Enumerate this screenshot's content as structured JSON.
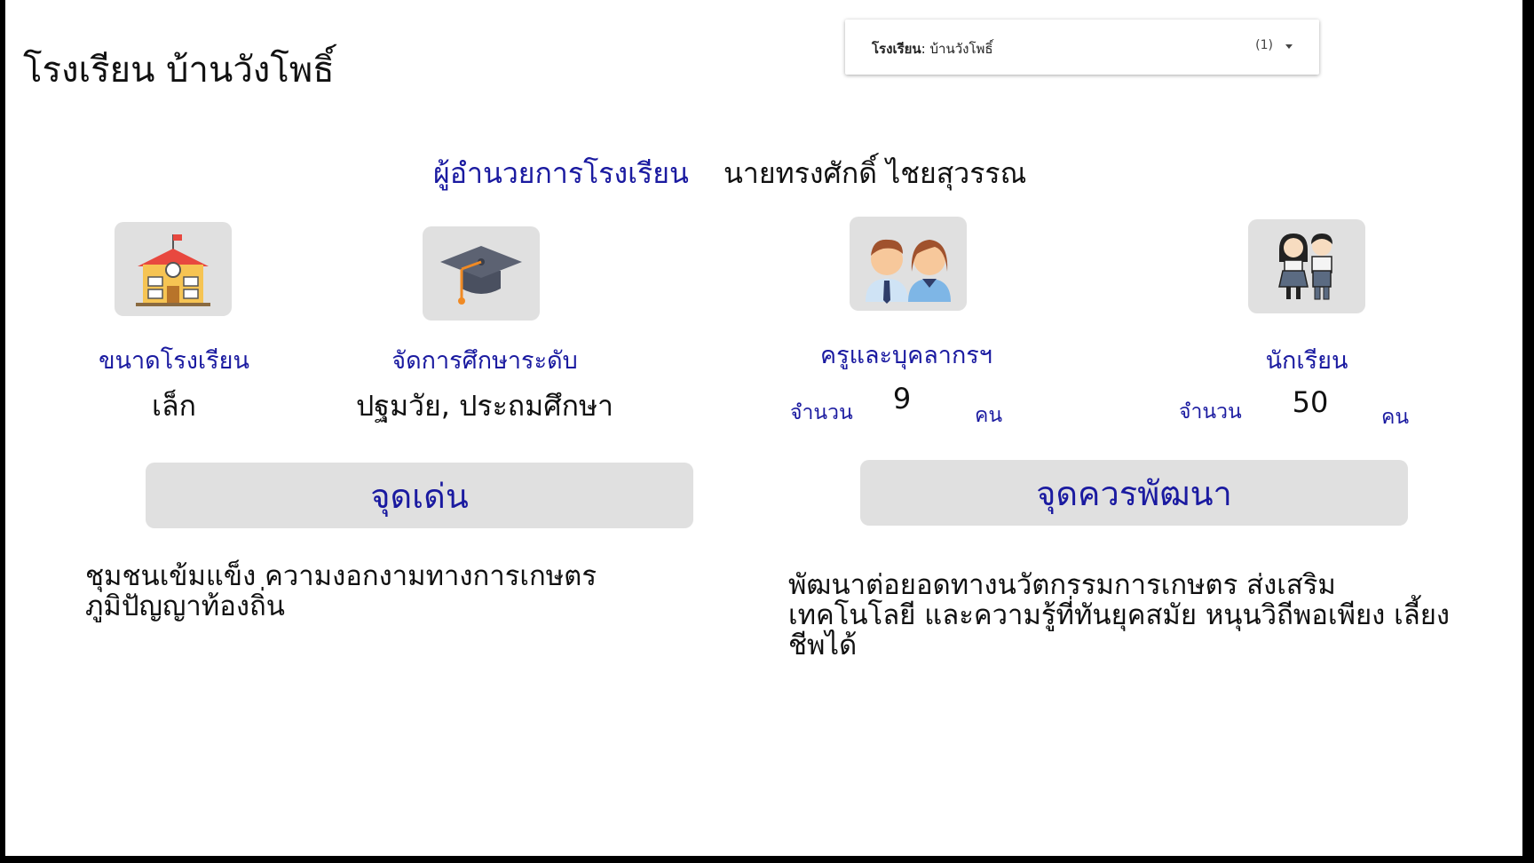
{
  "page_title": "โรงเรียน บ้านวังโพธิ์",
  "filter": {
    "label": "โรงเรียน",
    "value": "บ้านวังโพธิ์",
    "count": "(1)"
  },
  "director": {
    "label": "ผู้อำนวยการโรงเรียน",
    "name": "นายทรงศักดิ์ ไชยสุวรรณ"
  },
  "stats": {
    "size": {
      "label": "ขนาดโรงเรียน",
      "value": "เล็ก",
      "icon": "school-building-icon"
    },
    "level": {
      "label": "จัดการศึกษาระดับ",
      "value": "ปฐมวัย, ประถมศึกษา",
      "icon": "graduation-cap-icon"
    },
    "teachers": {
      "label": "ครูและบุคลากรฯ",
      "prefix": "จำนวน",
      "value": "9",
      "unit": "คน",
      "icon": "teachers-icon"
    },
    "students": {
      "label": "นักเรียน",
      "prefix": "จำนวน",
      "value": "50",
      "unit": "คน",
      "icon": "students-icon"
    }
  },
  "strengths": {
    "heading": "จุดเด่น",
    "text": "ชุมชนเข้มแข็ง ความงอกงามทางการเกษตร ภูมิปัญญาท้องถิ่น"
  },
  "improvements": {
    "heading": "จุดควรพัฒนา",
    "text": "พัฒนาต่อยอดทางนวัตกรรมการเกษตร ส่งเสริมเทคโนโลยี และความรู้ที่ทันยุคสมัย หนุนวิถีพอเพียง เลี้ยงชีพได้"
  },
  "colors": {
    "accent": "#1a1aa0",
    "tile": "#e0e0e0"
  }
}
